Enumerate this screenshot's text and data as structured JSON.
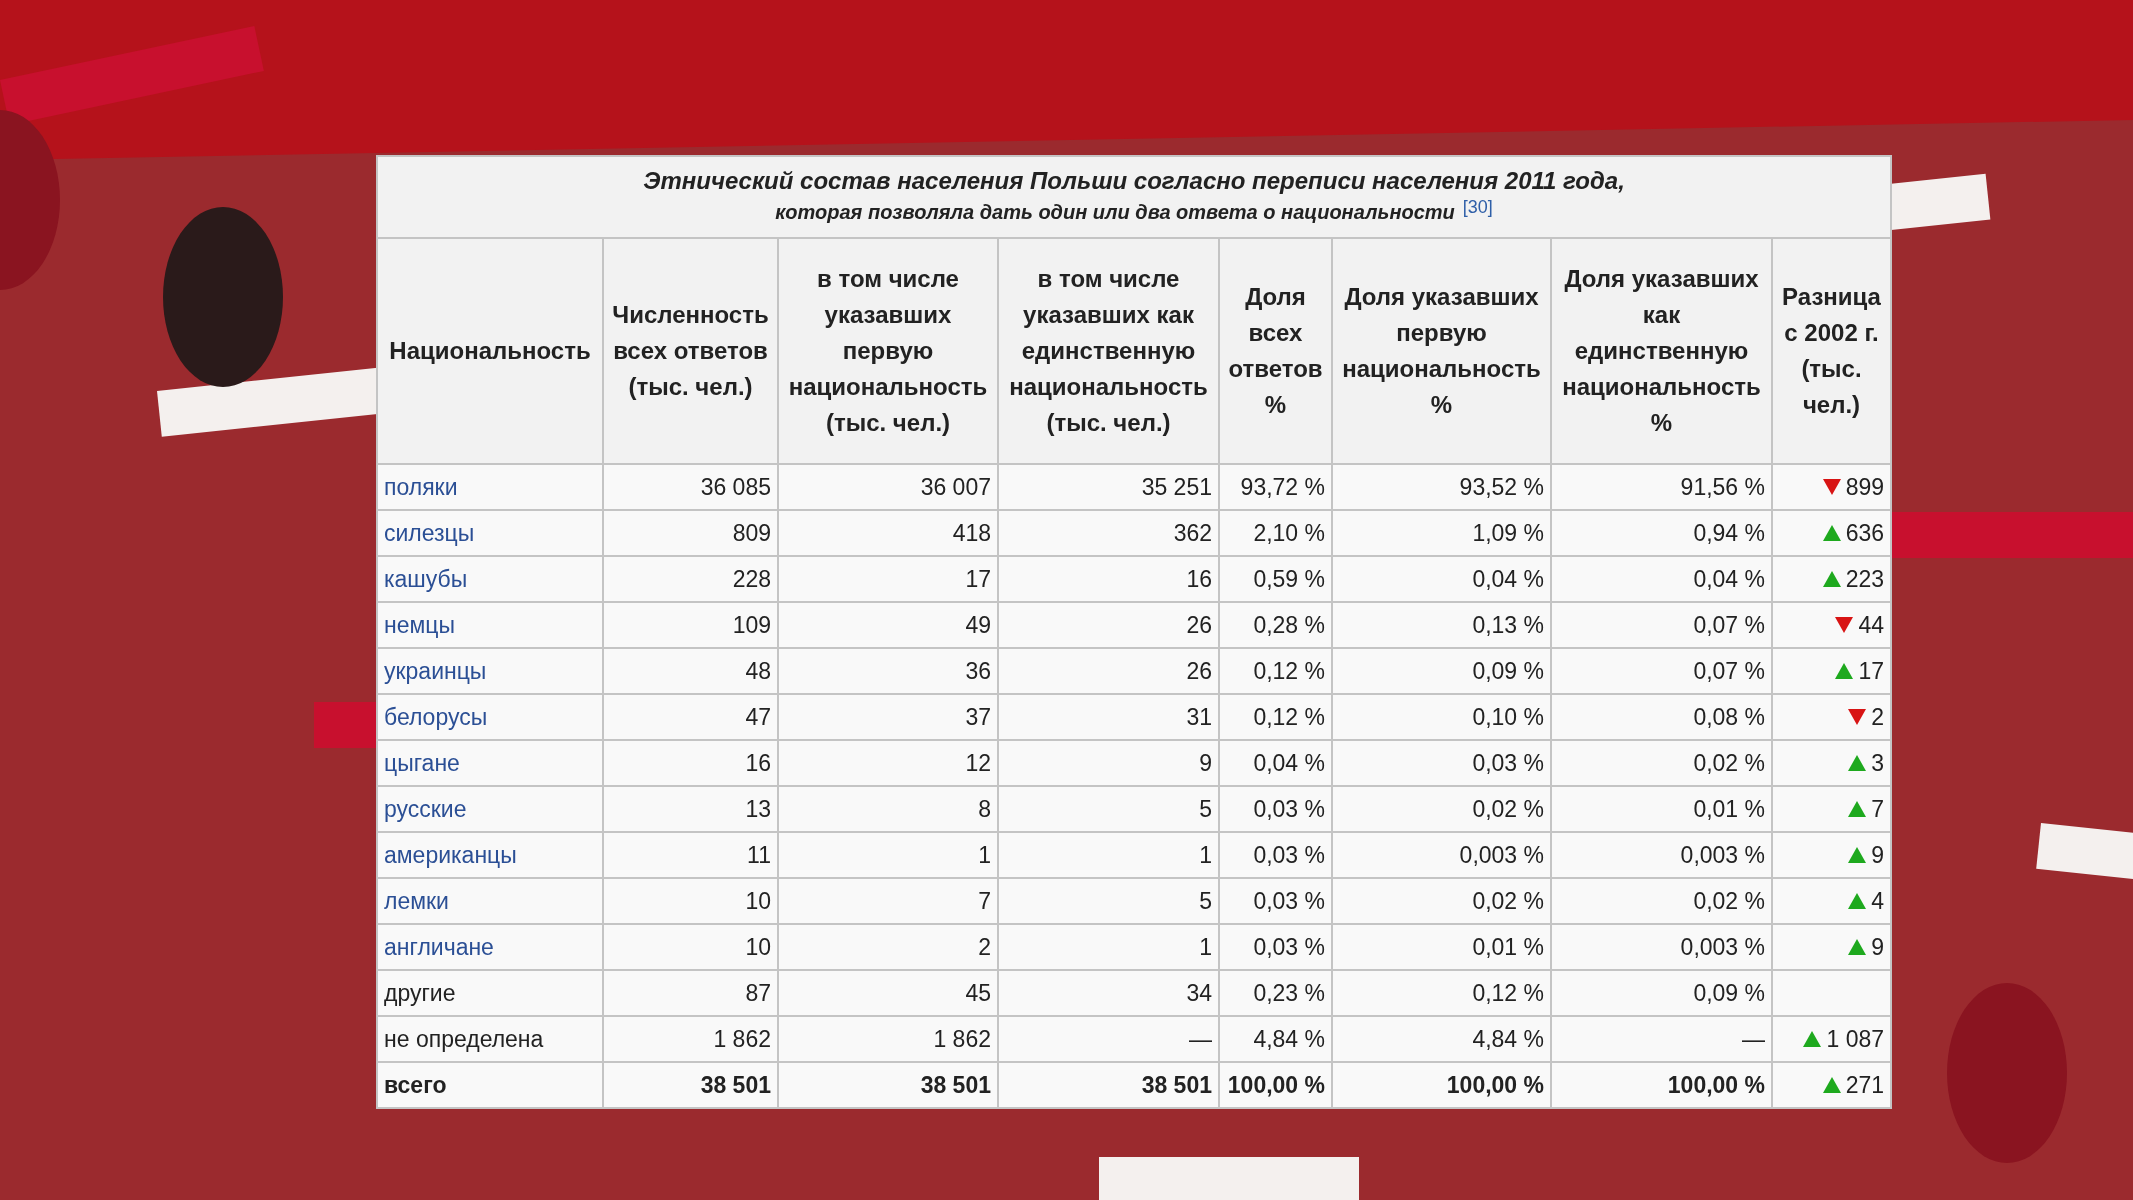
{
  "caption": {
    "title": "Этнический состав населения Польши согласно переписи населения 2011 года,",
    "subtitle": "которая позволяла дать один или два ответа о национальности",
    "ref": "[30]"
  },
  "table": {
    "columns": [
      "Национальность",
      "Численность всех ответов (тыс. чел.)",
      "в том числе указавших первую национальность (тыс. чел.)",
      "в том числе указавших как единственную национальность (тыс. чел.)",
      "Доля всех ответов %",
      "Доля указавших первую национальность %",
      "Доля указавших как единственную национальность %",
      "Разница с 2002 г. (тыс. чел.)"
    ],
    "rows": [
      {
        "kind": "link",
        "cells": [
          "поляки",
          "36 085",
          "36 007",
          "35 251",
          "93,72 %",
          "93,52 %",
          "91,56 %",
          "899"
        ],
        "increase": false
      },
      {
        "kind": "link",
        "cells": [
          "силезцы",
          "809",
          "418",
          "362",
          "2,10 %",
          "1,09 %",
          "0,94 %",
          "636"
        ],
        "increase": true
      },
      {
        "kind": "link",
        "cells": [
          "кашубы",
          "228",
          "17",
          "16",
          "0,59 %",
          "0,04 %",
          "0,04 %",
          "223"
        ],
        "increase": true
      },
      {
        "kind": "link",
        "cells": [
          "немцы",
          "109",
          "49",
          "26",
          "0,28 %",
          "0,13 %",
          "0,07 %",
          "44"
        ],
        "increase": false
      },
      {
        "kind": "link",
        "cells": [
          "украинцы",
          "48",
          "36",
          "26",
          "0,12 %",
          "0,09 %",
          "0,07 %",
          "17"
        ],
        "increase": true
      },
      {
        "kind": "link",
        "cells": [
          "белорусы",
          "47",
          "37",
          "31",
          "0,12 %",
          "0,10 %",
          "0,08 %",
          "2"
        ],
        "increase": false
      },
      {
        "kind": "link",
        "cells": [
          "цыгане",
          "16",
          "12",
          "9",
          "0,04 %",
          "0,03 %",
          "0,02 %",
          "3"
        ],
        "increase": true
      },
      {
        "kind": "link",
        "cells": [
          "русские",
          "13",
          "8",
          "5",
          "0,03 %",
          "0,02 %",
          "0,01 %",
          "7"
        ],
        "increase": true
      },
      {
        "kind": "link",
        "cells": [
          "американцы",
          "11",
          "1",
          "1",
          "0,03 %",
          "0,003 %",
          "0,003 %",
          "9"
        ],
        "increase": true
      },
      {
        "kind": "link",
        "cells": [
          "лемки",
          "10",
          "7",
          "5",
          "0,03 %",
          "0,02 %",
          "0,02 %",
          "4"
        ],
        "increase": true
      },
      {
        "kind": "link",
        "cells": [
          "англичане",
          "10",
          "2",
          "1",
          "0,03 %",
          "0,01 %",
          "0,003 %",
          "9"
        ],
        "increase": true
      },
      {
        "kind": "plain",
        "cells": [
          "другие",
          "87",
          "45",
          "34",
          "0,23 %",
          "0,12 %",
          "0,09 %",
          ""
        ]
      },
      {
        "kind": "plain",
        "cells": [
          "не определена",
          "1 862",
          "1 862",
          "—",
          "4,84 %",
          "4,84 %",
          "—",
          "1 087"
        ],
        "increase": true
      },
      {
        "kind": "total",
        "cells": [
          "всего",
          "38 501",
          "38 501",
          "38 501",
          "100,00 %",
          "100,00 %",
          "100,00 %",
          "271"
        ],
        "increase": true
      }
    ]
  }
}
